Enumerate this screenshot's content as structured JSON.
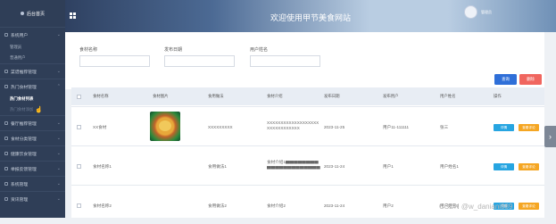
{
  "sidebar": {
    "title": "后台首页",
    "menu": [
      {
        "label": "系统用户",
        "subs": [
          "管理员",
          "普通用户"
        ]
      },
      {
        "label": "菜谱推荐管理",
        "subs": []
      },
      {
        "label": "热门食材管理",
        "subs": [
          "热门食材列表",
          "热门食材添加"
        ]
      },
      {
        "label": "餐厅推荐管理",
        "subs": []
      },
      {
        "label": "食材分类管理",
        "subs": []
      },
      {
        "label": "健康饮食管理",
        "subs": []
      },
      {
        "label": "举报反馈管理",
        "subs": []
      },
      {
        "label": "系统管理",
        "subs": []
      },
      {
        "label": "资讯管理",
        "subs": []
      }
    ]
  },
  "header": {
    "title": "欢迎使用甲节美食网站",
    "user_name": "管理员"
  },
  "search": {
    "fields": [
      {
        "label": "食材名称",
        "value": ""
      },
      {
        "label": "发布日期",
        "value": ""
      },
      {
        "label": "用户姓名",
        "value": ""
      }
    ],
    "search_label": "查询",
    "delete_label": "删除"
  },
  "table": {
    "headers": [
      "食材名称",
      "食材图片",
      "食用做法",
      "食材介绍",
      "发布日期",
      "发布用户",
      "用户姓名",
      "操作"
    ],
    "rows": [
      {
        "name": "XX食材",
        "has_image": true,
        "method": "XXXXXXXXX",
        "intro": "XXXXXXXXXXXXXXXXXXXXXXXXXXXXXXX",
        "date": "2023-11-25",
        "user": "用户11-111111",
        "username": "张三"
      },
      {
        "name": "食材名称1",
        "has_image": false,
        "method": "食用做法1",
        "intro": "食材介绍1▆▆▆▆▆▆▆▆▆▆▆▆▆▆▆▆▆▆▆▆▆",
        "date": "2023-11-24",
        "user": "用户1",
        "username": "用户姓名1"
      },
      {
        "name": "食材名称2",
        "has_image": false,
        "method": "食用做法2",
        "intro": "食材介绍2",
        "date": "2023-11-24",
        "user": "用户2",
        "username": "用户姓名2"
      }
    ],
    "detail_label": "详情",
    "review_label": "查看评论"
  },
  "watermark": "CSDN @w_daniani889"
}
